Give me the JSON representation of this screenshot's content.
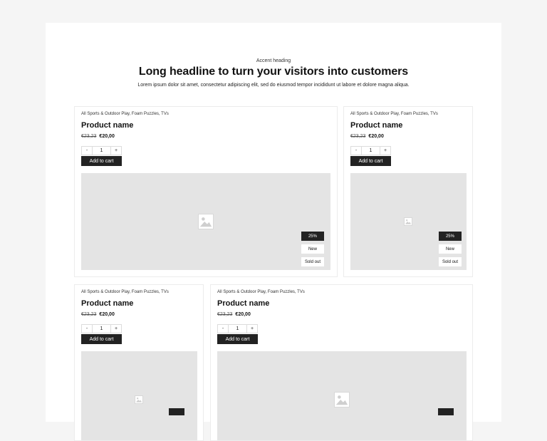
{
  "hero": {
    "accent": "Accent heading",
    "headline": "Long headline to turn your visitors into customers",
    "lead": "Lorem ipsum dolor sit amet, consectetur adipiscing elit, sed do eiusmod tempor incididunt ut labore et dolore magna aliqua."
  },
  "products": [
    {
      "categories": "All Sports & Outdoor Play, Foam Puzzles, TVs",
      "name": "Product name",
      "old_price": "€23,23",
      "price": "€20,00",
      "qty": "1",
      "minus": "-",
      "plus": "+",
      "cart": "Add to cart",
      "badges": [
        "25%",
        "New",
        "Sold out"
      ]
    },
    {
      "categories": "All Sports & Outdoor Play, Foam Puzzles, TVs",
      "name": "Product name",
      "old_price": "€23,23",
      "price": "€20,00",
      "qty": "1",
      "minus": "-",
      "plus": "+",
      "cart": "Add to cart",
      "badges": [
        "25%",
        "New",
        "Sold out"
      ]
    },
    {
      "categories": "All Sports & Outdoor Play, Foam Puzzles, TVs",
      "name": "Product name",
      "old_price": "€23,23",
      "price": "€20,00",
      "qty": "1",
      "minus": "-",
      "plus": "+",
      "cart": "Add to cart",
      "badges": []
    },
    {
      "categories": "All Sports & Outdoor Play, Foam Puzzles, TVs",
      "name": "Product name",
      "old_price": "€23,23",
      "price": "€20,00",
      "qty": "1",
      "minus": "-",
      "plus": "+",
      "cart": "Add to cart",
      "badges": []
    }
  ]
}
